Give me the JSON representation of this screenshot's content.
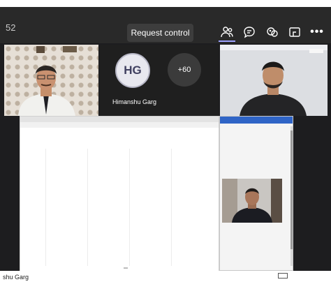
{
  "meeting": {
    "timer": "52",
    "request_control_label": "Request control",
    "more_label": "•••"
  },
  "toolbar_icons": [
    "people-icon",
    "chat-icon",
    "reactions-icon",
    "share-tray-icon",
    "more-icon"
  ],
  "participants": {
    "avatar_initials": "HG",
    "avatar_name": "Himanshu Garg",
    "overflow_count": "+60"
  },
  "presenter_name": "shu Garg",
  "colors": {
    "toolbar_bg": "#292929",
    "stage_bg": "#1d1d1f",
    "accent": "#9ea2ff",
    "share_panel_header": "#2f64c6"
  }
}
